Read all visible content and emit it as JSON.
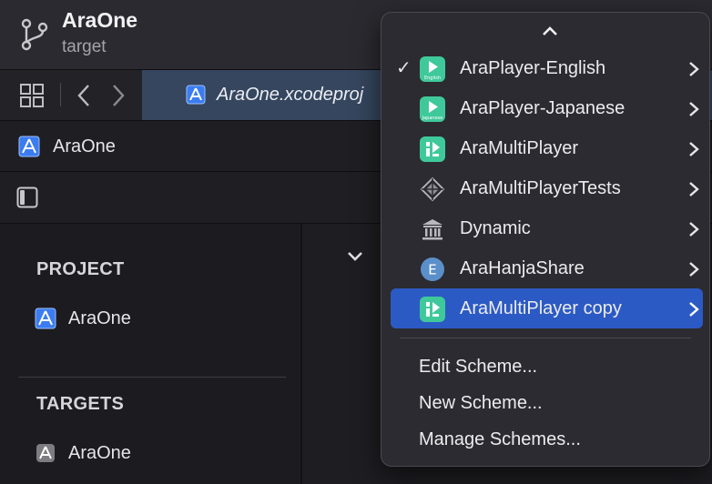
{
  "titlebar": {
    "title": "AraOne",
    "subtitle": "target"
  },
  "tabbar": {
    "active_tab": "AraOne.xcodeproj"
  },
  "pathbar": {
    "item": "AraOne"
  },
  "sidebar": {
    "project_header": "PROJECT",
    "project_item": "AraOne",
    "targets_header": "TARGETS",
    "target_item": "AraOne"
  },
  "menu": {
    "items": [
      {
        "label": "AraPlayer-English",
        "checked": true,
        "icon": "play-english-icon",
        "icon_text": "English"
      },
      {
        "label": "AraPlayer-Japanese",
        "checked": false,
        "icon": "play-japanese-icon",
        "icon_text": "Japanese"
      },
      {
        "label": "AraMultiPlayer",
        "checked": false,
        "icon": "multiplayer-icon"
      },
      {
        "label": "AraMultiPlayerTests",
        "checked": false,
        "icon": "tests-diamond-icon"
      },
      {
        "label": "Dynamic",
        "checked": false,
        "icon": "library-icon"
      },
      {
        "label": "AraHanjaShare",
        "checked": false,
        "icon": "extension-e-icon",
        "icon_text": "E"
      },
      {
        "label": "AraMultiPlayer copy",
        "checked": false,
        "selected": true,
        "icon": "multiplayer-icon"
      }
    ],
    "check_glyph": "✓",
    "actions": [
      "Edit Scheme...",
      "New Scheme...",
      "Manage Schemes..."
    ]
  },
  "colors": {
    "accent_selection": "#2c5ac4",
    "app_icon_green": "#3fc99a",
    "project_icon_blue": "#3b7cf0"
  }
}
